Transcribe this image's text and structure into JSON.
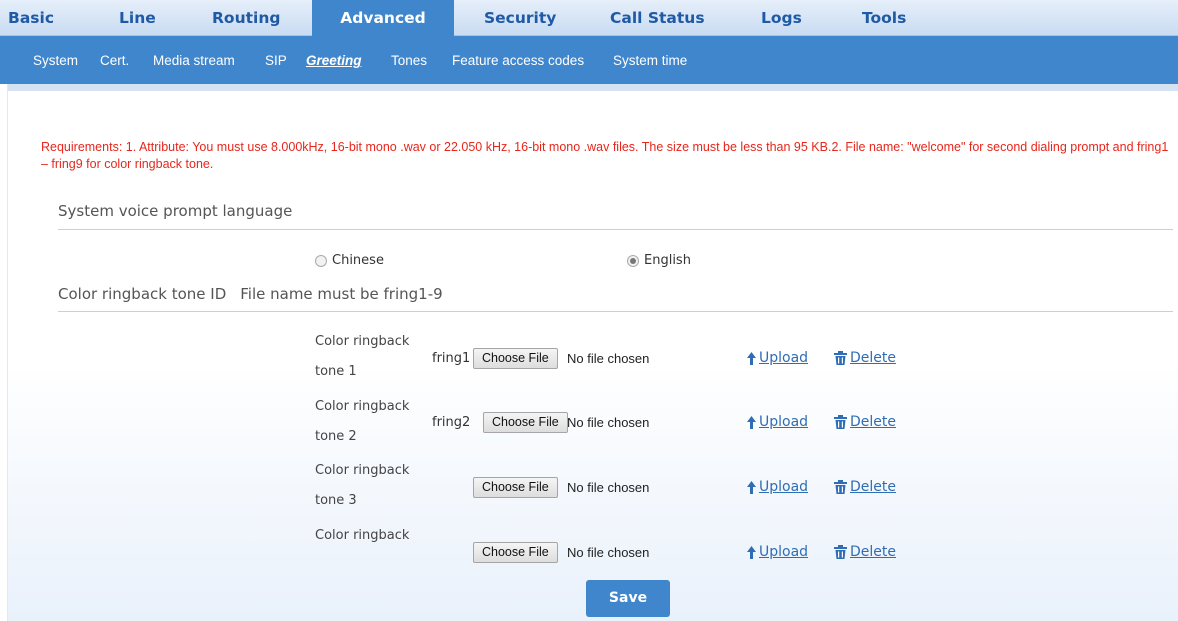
{
  "topnav": {
    "tabs": [
      {
        "label": "Basic"
      },
      {
        "label": "Line"
      },
      {
        "label": "Routing"
      },
      {
        "label": "Advanced"
      },
      {
        "label": "Security"
      },
      {
        "label": "Call Status"
      },
      {
        "label": "Logs"
      },
      {
        "label": "Tools"
      }
    ],
    "active": "Advanced"
  },
  "subnav": {
    "items": [
      {
        "label": "System"
      },
      {
        "label": "Cert."
      },
      {
        "label": "Media stream"
      },
      {
        "label": "SIP"
      },
      {
        "label": "Greeting"
      },
      {
        "label": "Tones"
      },
      {
        "label": "Feature access codes"
      },
      {
        "label": "System time"
      }
    ],
    "active": "Greeting"
  },
  "requirements": "Requirements: 1. Attribute: You must use 8.000kHz, 16-bit mono .wav or 22.050 kHz, 16-bit mono .wav files. The size must be less than 95 KB.2. File name:  \"welcome\" for second dialing prompt and fring1 – fring9 for color ringback tone.",
  "language_section": {
    "title": "System voice prompt language",
    "options": [
      {
        "label": "Chinese",
        "selected": false
      },
      {
        "label": "English",
        "selected": true
      }
    ]
  },
  "ringback_section": {
    "title": "Color ringback tone ID",
    "hint": "File name must be fring1-9",
    "rows": [
      {
        "label_line1": "Color ringback",
        "label_line2": "tone 1",
        "file_name": "fring1",
        "choose_label": "Choose File",
        "file_status": "No file chosen",
        "upload_label": "Upload",
        "delete_label": "Delete"
      },
      {
        "label_line1": "Color ringback",
        "label_line2": "tone 2",
        "file_name": "fring2",
        "choose_label": "Choose File",
        "file_status": "No file chosen",
        "upload_label": "Upload",
        "delete_label": "Delete"
      },
      {
        "label_line1": "Color ringback",
        "label_line2": "tone 3",
        "file_name": "",
        "choose_label": "Choose File",
        "file_status": "No file chosen",
        "upload_label": "Upload",
        "delete_label": "Delete"
      },
      {
        "label_line1": "Color ringback",
        "label_line2": "",
        "file_name": "",
        "choose_label": "Choose File",
        "file_status": "No file chosen",
        "upload_label": "Upload",
        "delete_label": "Delete"
      }
    ]
  },
  "save_label": "Save",
  "colors": {
    "nav_blue": "#3f86cc",
    "tab_text": "#1f5aa6",
    "requirement_red": "#e8261c",
    "link_blue": "#2f6db5"
  },
  "icons": {
    "upload": "arrow-up-icon",
    "delete": "trash-icon"
  }
}
